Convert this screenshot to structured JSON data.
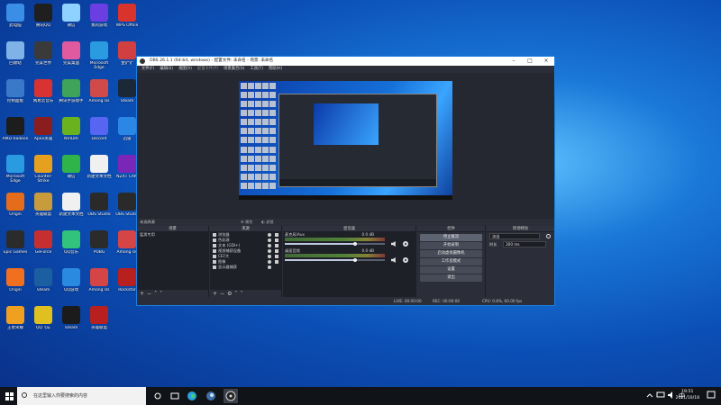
{
  "desktop": {
    "icons": [
      {
        "label": "此电脑",
        "color": "#3a8ee6"
      },
      {
        "label": "腾讯QQ",
        "color": "#1f1f1f"
      },
      {
        "label": "微信",
        "color": "#8fd2ff"
      },
      {
        "label": "我的游戏",
        "color": "#6a3ee0"
      },
      {
        "label": "WPS Office",
        "color": "#d9332e"
      },
      {
        "label": "回收站",
        "color": "#7fb3e8"
      },
      {
        "label": "完美世界",
        "color": "#3a3a3a"
      },
      {
        "label": "完美桌面",
        "color": "#e05aa0"
      },
      {
        "label": "Microsoft Edge",
        "color": "#2a9be0"
      },
      {
        "label": "金铲铲",
        "color": "#d14040"
      },
      {
        "label": "控制面板",
        "color": "#3a78c8"
      },
      {
        "label": "网易云音乐",
        "color": "#d83232"
      },
      {
        "label": "腾讯手游助手",
        "color": "#3fa35a"
      },
      {
        "label": "Among Us",
        "color": "#d14a4a"
      },
      {
        "label": "Steam",
        "color": "#1b2838"
      },
      {
        "label": "AMD Radeon",
        "color": "#1d1d1d"
      },
      {
        "label": "Apex英雄",
        "color": "#8a1d1d"
      },
      {
        "label": "NVIDIA",
        "color": "#6ab31e"
      },
      {
        "label": "Discord",
        "color": "#5865f2"
      },
      {
        "label": "迅雷",
        "color": "#2b86e6"
      },
      {
        "label": "Microsoft Edge",
        "color": "#2a9be0"
      },
      {
        "label": "Counter-Strike",
        "color": "#e6a020"
      },
      {
        "label": "微信",
        "color": "#2fb44a"
      },
      {
        "label": "新建文本文档",
        "color": "#f0f0f0"
      },
      {
        "label": "NZXT CAM",
        "color": "#7a27b8"
      },
      {
        "label": "Origin",
        "color": "#e56c1b"
      },
      {
        "label": "英雄联盟",
        "color": "#c89b3c"
      },
      {
        "label": "新建文本文档",
        "color": "#f0f0f0"
      },
      {
        "label": "OBS Studio",
        "color": "#2a2a2a"
      },
      {
        "label": "OBS Studio",
        "color": "#2a2a2a"
      },
      {
        "label": "Epic Games",
        "color": "#2b2b2b"
      },
      {
        "label": "GeForce",
        "color": "#c62f2f"
      },
      {
        "label": "QQ音乐",
        "color": "#31c27c"
      },
      {
        "label": "PUBG",
        "color": "#2b2b2b"
      },
      {
        "label": "Among Us",
        "color": "#d64545"
      },
      {
        "label": "Origin",
        "color": "#f07020"
      },
      {
        "label": "Steam",
        "color": "#1b5fa0"
      },
      {
        "label": "QQ游戏",
        "color": "#2a8ae0"
      },
      {
        "label": "Among Us",
        "color": "#d64545"
      },
      {
        "label": "Rockstar",
        "color": "#b81f1f"
      },
      {
        "label": "王者荣耀",
        "color": "#f0a020"
      },
      {
        "label": "QQ飞车",
        "color": "#e0c020"
      },
      {
        "label": "Steam",
        "color": "#1b1b1b"
      },
      {
        "label": "英雄联盟",
        "color": "#b81f1f"
      }
    ]
  },
  "obs": {
    "title": "OBS 26.1.1 (64-bit, windows) - 配置文件: 未命名 - 场景: 未命名",
    "menu": [
      "文件(F)",
      "编辑(E)",
      "视图(V)",
      "配置文件(P)",
      "场景集合(S)",
      "工具(T)",
      "帮助(H)"
    ],
    "scene_info": "未选择源",
    "props_label": "属性",
    "filters_label": "滤镜",
    "docks": {
      "scenes": {
        "title": "场景",
        "items": [
          "猛男专用"
        ]
      },
      "sources": {
        "title": "来源",
        "items": [
          "浏览器",
          "色彩源",
          "文本 (GDI+)",
          "视频捕获设备",
          "CEF大",
          "图像",
          "显示器捕获"
        ]
      },
      "mixer": {
        "title": "混音器",
        "tracks": [
          {
            "name": "麦克风/Aux",
            "db": "0.0 dB",
            "level": 0.7
          },
          {
            "name": "桌面音频",
            "db": "0.0 dB",
            "level": 0.7
          }
        ]
      },
      "controls": {
        "title": "控件",
        "buttons": [
          "停止推流",
          "开始录制",
          "启动虚拟摄像机",
          "工作室模式",
          "设置",
          "退出"
        ]
      },
      "transitions": {
        "title": "转场特效",
        "type_value": "淡出",
        "duration_label": "时长",
        "duration_value": "300 ms"
      }
    },
    "status": {
      "live": "LIVE: 00:00:00",
      "rec": "REC: 00:00:00",
      "cpu": "CPU: 0.8%, 60.00 fps"
    }
  },
  "taskbar": {
    "search_placeholder": "在这里输入你要搜索的内容",
    "time": "19:51",
    "date": "2021/10/18"
  }
}
